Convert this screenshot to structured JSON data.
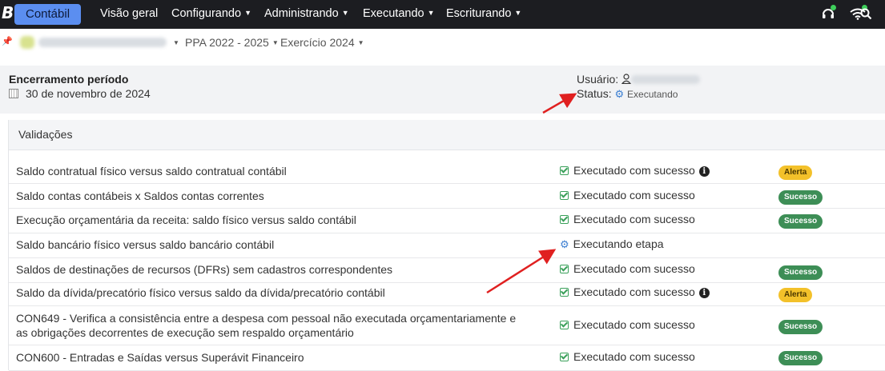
{
  "topbar": {
    "logo": "B",
    "module": "Contábil",
    "nav": [
      {
        "label": "Visão geral",
        "has_caret": false
      },
      {
        "label": "Configurando",
        "has_caret": true
      },
      {
        "label": "Administrando",
        "has_caret": true
      },
      {
        "label": "Executando",
        "has_caret": true
      },
      {
        "label": "Escriturando",
        "has_caret": true
      }
    ],
    "icons": [
      "headset-icon",
      "wifi-icon",
      "search-icon"
    ]
  },
  "breadcrumb": {
    "ppa": "PPA 2022 - 2025",
    "exercicio": "Exercício 2024"
  },
  "header": {
    "title": "Encerramento período",
    "date": "30 de novembro de 2024",
    "user_label": "Usuário:",
    "status_label": "Status:",
    "status_value": "Executando"
  },
  "validations": {
    "title": "Validações",
    "rows": [
      {
        "text": "Saldo contratual físico versus saldo contratual contábil",
        "status": "Executado com sucesso",
        "info": true,
        "badge": "Alerta",
        "badge_type": "alert"
      },
      {
        "text": "Saldo contas contábeis x Saldos contas correntes",
        "status": "Executado com sucesso",
        "info": false,
        "badge": "Sucesso",
        "badge_type": "ok"
      },
      {
        "text": "Execução orçamentária da receita: saldo físico versus saldo contábil",
        "status": "Executado com sucesso",
        "info": false,
        "badge": "Sucesso",
        "badge_type": "ok"
      },
      {
        "text": "Saldo bancário físico versus saldo bancário contábil",
        "status": "Executando etapa",
        "info": false,
        "badge": "",
        "badge_type": "running"
      },
      {
        "text": "Saldos de destinações de recursos (DFRs) sem cadastros correspondentes",
        "status": "Executado com sucesso",
        "info": false,
        "badge": "Sucesso",
        "badge_type": "ok"
      },
      {
        "text": "Saldo da dívida/precatório físico versus saldo da dívida/precatório contábil",
        "status": "Executado com sucesso",
        "info": true,
        "badge": "Alerta",
        "badge_type": "alert"
      },
      {
        "text": "CON649 - Verifica a consistência entre a despesa com pessoal não executada orçamentariamente e as obrigações decorrentes de execução sem respaldo orçamentário",
        "status": "Executado com sucesso",
        "info": false,
        "badge": "Sucesso",
        "badge_type": "ok"
      },
      {
        "text": "CON600 - Entradas e Saídas versus Superávit Financeiro",
        "status": "Executado com sucesso",
        "info": false,
        "badge": "Sucesso",
        "badge_type": "ok"
      }
    ]
  },
  "colors": {
    "topbar": "#1c1d21",
    "module_accent": "#5b8ef0",
    "success_badge": "#3d8e56",
    "alert_badge": "#f3c12a",
    "annotation_arrow": "#e02020",
    "running_gear": "#3b7ed1"
  }
}
